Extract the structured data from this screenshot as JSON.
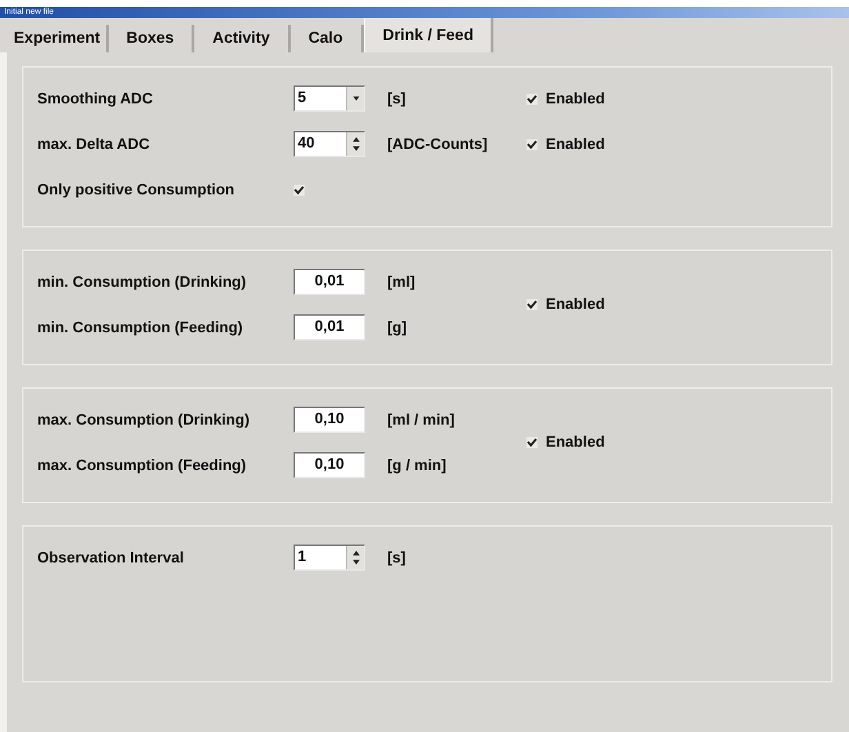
{
  "window": {
    "title": "Initial new file"
  },
  "tabs": [
    {
      "label": "Experiment",
      "selected": false
    },
    {
      "label": "Boxes",
      "selected": false
    },
    {
      "label": "Activity",
      "selected": false
    },
    {
      "label": "Calo",
      "selected": false
    },
    {
      "label": "Drink / Feed",
      "selected": true
    }
  ],
  "groups": [
    {
      "rows": [
        {
          "label": "Smoothing ADC",
          "control": {
            "kind": "dropdown",
            "value": "5"
          },
          "unit": "[s]",
          "enabled": {
            "label": "Enabled",
            "checked": true
          }
        },
        {
          "label": "max. Delta ADC",
          "control": {
            "kind": "spin",
            "value": "40"
          },
          "unit": "[ADC-Counts]",
          "enabled": {
            "label": "Enabled",
            "checked": true
          }
        },
        {
          "label": "Only positive Consumption",
          "control": {
            "kind": "checkbox",
            "checked": true
          }
        }
      ]
    },
    {
      "rows": [
        {
          "label": "min. Consumption (Drinking)",
          "control": {
            "kind": "text",
            "value": "0,01"
          },
          "unit": "[ml]"
        },
        {
          "label": "min. Consumption (Feeding)",
          "control": {
            "kind": "text",
            "value": "0,01"
          },
          "unit": "[g]"
        }
      ],
      "enabled": {
        "label": "Enabled",
        "checked": true
      }
    },
    {
      "rows": [
        {
          "label": "max. Consumption (Drinking)",
          "control": {
            "kind": "text",
            "value": "0,10"
          },
          "unit": "[ml / min]"
        },
        {
          "label": "max. Consumption (Feeding)",
          "control": {
            "kind": "text",
            "value": "0,10"
          },
          "unit": "[g / min]"
        }
      ],
      "enabled": {
        "label": "Enabled",
        "checked": true
      }
    },
    {
      "rows": [
        {
          "label": "Observation Interval",
          "control": {
            "kind": "spin",
            "value": "1"
          },
          "unit": "[s]"
        }
      ]
    }
  ]
}
